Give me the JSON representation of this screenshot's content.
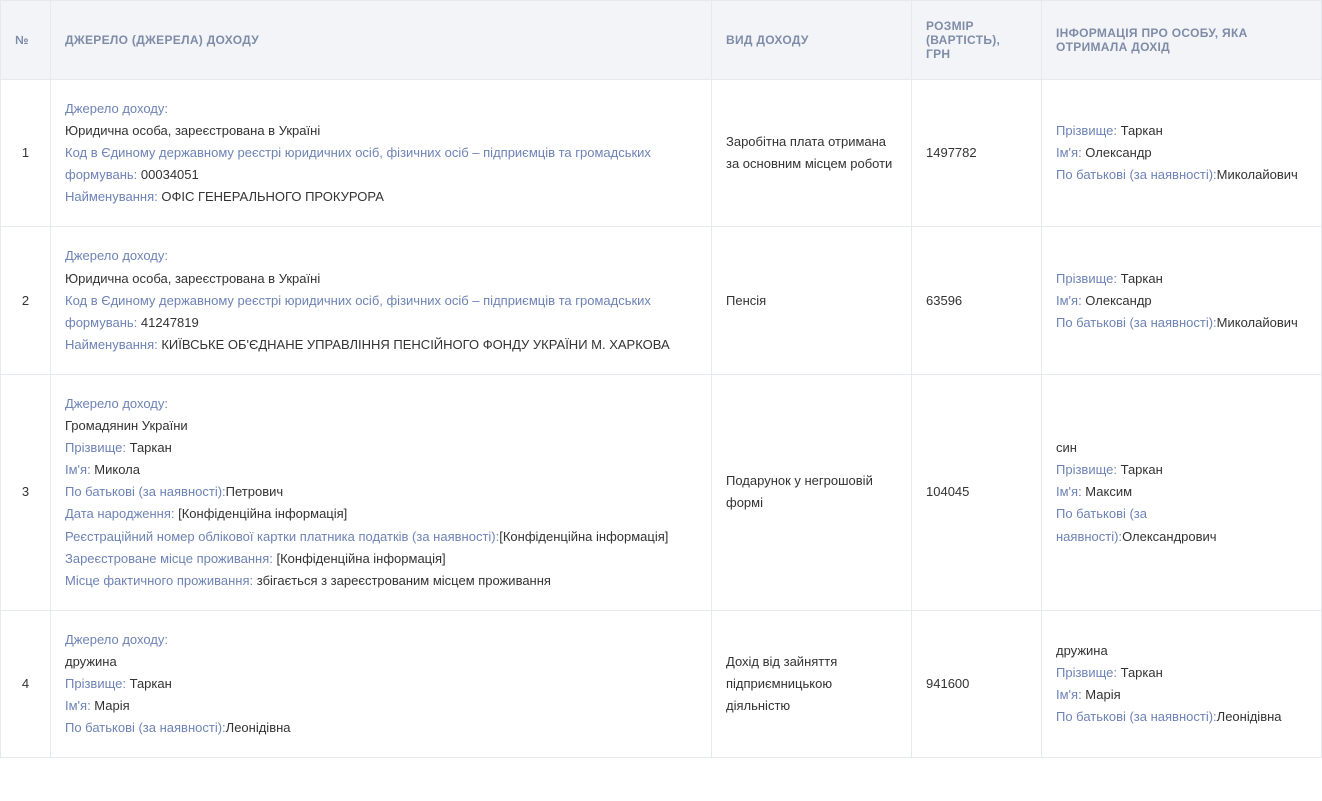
{
  "headers": {
    "num": "№",
    "source": "ДЖЕРЕЛО (ДЖЕРЕЛА) ДОХОДУ",
    "type": "ВИД ДОХОДУ",
    "amount": "РОЗМІР (ВАРТІСТЬ), ГРН",
    "person": "ІНФОРМАЦІЯ ПРО ОСОБУ, ЯКА ОТРИМАЛА ДОХІД"
  },
  "labels": {
    "sourceHeader": "Джерело доходу:",
    "code": "Код в Єдиному державному реєстрі юридичних осіб, фізичних осіб – підприємців та громадських формувань: ",
    "name": "Найменування: ",
    "surname": "Прізвище: ",
    "firstname": "Ім'я: ",
    "patronymic": "По батькові (за наявності):",
    "dob": "Дата народження: ",
    "taxid": "Реєстраційний номер облікової картки платника податків (за наявності):",
    "regAddr": "Зареєстроване місце проживання: ",
    "actAddr": "Місце фактичного проживання: "
  },
  "rows": [
    {
      "num": "1",
      "source": {
        "entity": "Юридична особа, зареєстрована в Україні",
        "code": "00034051",
        "orgName": "ОФІС ГЕНЕРАЛЬНОГО ПРОКУРОРА"
      },
      "type": "Заробітна плата отримана за основним місцем роботи",
      "amount": "1497782",
      "person": {
        "surname": "Таркан",
        "firstname": "Олександр",
        "patronymic": "Миколайович"
      }
    },
    {
      "num": "2",
      "source": {
        "entity": "Юридична особа, зареєстрована в Україні",
        "code": "41247819",
        "orgName": "КИЇВСЬКЕ ОБ'ЄДНАНЕ УПРАВЛІННЯ ПЕНСІЙНОГО ФОНДУ УКРАЇНИ М. ХАРКОВА"
      },
      "type": "Пенсія",
      "amount": "63596",
      "person": {
        "surname": "Таркан",
        "firstname": "Олександр",
        "patronymic": "Миколайович"
      }
    },
    {
      "num": "3",
      "source": {
        "entity": "Громадянин України",
        "srcSurname": "Таркан",
        "srcFirstname": "Микола",
        "srcPatronymic": "Петрович",
        "dob": "[Конфіденційна інформація]",
        "taxid": "[Конфіденційна інформація]",
        "regAddr": "[Конфіденційна інформація]",
        "actAddr": "збігається з зареєстрованим місцем проживання"
      },
      "type": "Подарунок у негрошовій формі",
      "amount": "104045",
      "person": {
        "relation": "син",
        "surname": "Таркан",
        "firstname": "Максим",
        "patronymic": "Олександрович"
      }
    },
    {
      "num": "4",
      "source": {
        "entity": "дружина",
        "srcSurname": "Таркан",
        "srcFirstname": "Марія",
        "srcPatronymic": "Леонідівна"
      },
      "type": "Дохід від зайняття підприємницькою діяльністю",
      "amount": "941600",
      "person": {
        "relation": "дружина",
        "surname": "Таркан",
        "firstname": "Марія",
        "patronymic": "Леонідівна"
      }
    }
  ]
}
